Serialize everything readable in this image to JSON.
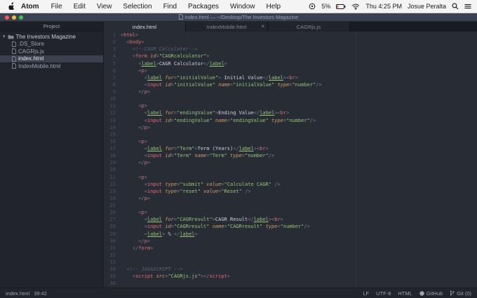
{
  "colors": {
    "editor_bg": "#282c34",
    "panel_bg": "#21252b",
    "titlebar_bg": "#3a4150",
    "tag_red": "#e06c75",
    "string_green": "#98c379",
    "attr_orange": "#d19a66",
    "comment_gray": "#5c6370",
    "selection_bg": "#3a404d"
  },
  "menubar": {
    "app": "Atom",
    "items": [
      "File",
      "Edit",
      "View",
      "Selection",
      "Find",
      "Packages",
      "Window",
      "Help"
    ],
    "battery_percent": "5%",
    "clock": "Thu 4:25 PM",
    "user": "Josue Peralta"
  },
  "window": {
    "title": "index.html — ~/Desktop/The Investors Magazine"
  },
  "sidebar": {
    "header": "Project",
    "root_folder": "The Investors Magazine",
    "files": [
      ".DS_Store",
      "CAGRjs.js",
      "index.html",
      "IndexMobile.html"
    ],
    "selected_file": "index.html"
  },
  "tabs": [
    {
      "label": "index.html",
      "active": true,
      "closable": false
    },
    {
      "label": "IndexMobile.html",
      "active": false,
      "closable": true
    },
    {
      "label": "CAGRjs.js",
      "active": false,
      "closable": false
    }
  ],
  "glyphs": {
    "close": "×",
    "disclosure": "▾"
  },
  "statusbar": {
    "file": "index.html",
    "cursor": "39:42",
    "items": [
      "LF",
      "UTF-8",
      "HTML"
    ],
    "github_label": "GitHub",
    "git_label": "Git (0)"
  },
  "editor": {
    "lines": [
      [
        [
          "pl",
          "<"
        ],
        [
          "tg",
          "html"
        ],
        [
          "pl",
          ">"
        ]
      ],
      [
        [
          "pl",
          "  <"
        ],
        [
          "tg",
          "body"
        ],
        [
          "pl",
          ">"
        ]
      ],
      [
        [
          "cm",
          "    <!--CAGR Calculator-->"
        ]
      ],
      [
        [
          "pl",
          "    <"
        ],
        [
          "tg",
          "form"
        ],
        [
          "pl",
          " "
        ],
        [
          "at",
          "id"
        ],
        [
          "pl",
          "="
        ],
        [
          "st",
          "\"CAGRcalculator\""
        ],
        [
          "pl",
          ">"
        ]
      ],
      [
        [
          "pl",
          "      <"
        ],
        [
          "lb",
          "label"
        ],
        [
          "pl",
          ">"
        ],
        [
          "tx",
          "CAGR Calculator"
        ],
        [
          "pl",
          "</"
        ],
        [
          "lb",
          "label"
        ],
        [
          "pl",
          ">"
        ]
      ],
      [
        [
          "pl",
          "      <"
        ],
        [
          "tg",
          "p"
        ],
        [
          "pl",
          ">"
        ]
      ],
      [
        [
          "pl",
          "        <"
        ],
        [
          "lb",
          "label"
        ],
        [
          "pl",
          " "
        ],
        [
          "at",
          "for"
        ],
        [
          "pl",
          "="
        ],
        [
          "st",
          "\"initialValue\""
        ],
        [
          "pl",
          ">"
        ],
        [
          "tx",
          " Initial Value"
        ],
        [
          "pl",
          "</"
        ],
        [
          "lb",
          "label"
        ],
        [
          "pl",
          "><"
        ],
        [
          "tg",
          "br"
        ],
        [
          "pl",
          ">"
        ]
      ],
      [
        [
          "pl",
          "        <"
        ],
        [
          "tg",
          "input"
        ],
        [
          "pl",
          " "
        ],
        [
          "at",
          "id"
        ],
        [
          "pl",
          "="
        ],
        [
          "st",
          "\"initialValue\""
        ],
        [
          "pl",
          " "
        ],
        [
          "at",
          "name"
        ],
        [
          "pl",
          "="
        ],
        [
          "st",
          "\"initialValue\""
        ],
        [
          "pl",
          " "
        ],
        [
          "at",
          "type"
        ],
        [
          "pl",
          "="
        ],
        [
          "st",
          "\"number\""
        ],
        [
          "pl",
          "/>"
        ]
      ],
      [
        [
          "pl",
          "      </"
        ],
        [
          "tg",
          "p"
        ],
        [
          "pl",
          ">"
        ]
      ],
      [],
      [
        [
          "pl",
          "      <"
        ],
        [
          "tg",
          "p"
        ],
        [
          "pl",
          ">"
        ]
      ],
      [
        [
          "pl",
          "        <"
        ],
        [
          "lb",
          "label"
        ],
        [
          "pl",
          " "
        ],
        [
          "at",
          "for"
        ],
        [
          "pl",
          "="
        ],
        [
          "st",
          "\"endingValue\""
        ],
        [
          "pl",
          ">"
        ],
        [
          "tx",
          "Ending Value"
        ],
        [
          "pl",
          "</"
        ],
        [
          "lb",
          "label"
        ],
        [
          "pl",
          "><"
        ],
        [
          "tg",
          "br"
        ],
        [
          "pl",
          ">"
        ]
      ],
      [
        [
          "pl",
          "        <"
        ],
        [
          "tg",
          "input"
        ],
        [
          "pl",
          " "
        ],
        [
          "at",
          "id"
        ],
        [
          "pl",
          "="
        ],
        [
          "st",
          "\"endingValue\""
        ],
        [
          "pl",
          " "
        ],
        [
          "at",
          "name"
        ],
        [
          "pl",
          "="
        ],
        [
          "st",
          "\"endingValue\""
        ],
        [
          "pl",
          " "
        ],
        [
          "at",
          "type"
        ],
        [
          "pl",
          "="
        ],
        [
          "st",
          "\"number\""
        ],
        [
          "pl",
          "/>"
        ]
      ],
      [
        [
          "pl",
          "      </"
        ],
        [
          "tg",
          "p"
        ],
        [
          "pl",
          ">"
        ]
      ],
      [],
      [
        [
          "pl",
          "      <"
        ],
        [
          "tg",
          "p"
        ],
        [
          "pl",
          ">"
        ]
      ],
      [
        [
          "pl",
          "        <"
        ],
        [
          "lb",
          "label"
        ],
        [
          "pl",
          " "
        ],
        [
          "at",
          "for"
        ],
        [
          "pl",
          "="
        ],
        [
          "st",
          "\"Term\""
        ],
        [
          "pl",
          ">"
        ],
        [
          "tx",
          "Term (Years)"
        ],
        [
          "pl",
          "</"
        ],
        [
          "lb",
          "label"
        ],
        [
          "pl",
          "><"
        ],
        [
          "tg",
          "br"
        ],
        [
          "pl",
          ">"
        ]
      ],
      [
        [
          "pl",
          "        <"
        ],
        [
          "tg",
          "input"
        ],
        [
          "pl",
          " "
        ],
        [
          "at",
          "id"
        ],
        [
          "pl",
          "="
        ],
        [
          "st",
          "\"Term\""
        ],
        [
          "pl",
          " "
        ],
        [
          "at",
          "name"
        ],
        [
          "pl",
          "="
        ],
        [
          "st",
          "\"Term\""
        ],
        [
          "pl",
          " "
        ],
        [
          "at",
          "type"
        ],
        [
          "pl",
          "="
        ],
        [
          "st",
          "\"number\""
        ],
        [
          "pl",
          "/>"
        ]
      ],
      [
        [
          "pl",
          "      </"
        ],
        [
          "tg",
          "p"
        ],
        [
          "pl",
          ">"
        ]
      ],
      [],
      [
        [
          "pl",
          "      <"
        ],
        [
          "tg",
          "p"
        ],
        [
          "pl",
          ">"
        ]
      ],
      [
        [
          "pl",
          "        <"
        ],
        [
          "tg",
          "input"
        ],
        [
          "pl",
          " "
        ],
        [
          "at",
          "type"
        ],
        [
          "pl",
          "="
        ],
        [
          "st",
          "\"submit\""
        ],
        [
          "pl",
          " "
        ],
        [
          "at",
          "value"
        ],
        [
          "pl",
          "="
        ],
        [
          "st",
          "\"Calculate CAGR\""
        ],
        [
          "pl",
          " />"
        ]
      ],
      [
        [
          "pl",
          "        <"
        ],
        [
          "tg",
          "input"
        ],
        [
          "pl",
          " "
        ],
        [
          "at",
          "type"
        ],
        [
          "pl",
          "="
        ],
        [
          "st",
          "\"reset\""
        ],
        [
          "pl",
          " "
        ],
        [
          "at",
          "value"
        ],
        [
          "pl",
          "="
        ],
        [
          "st",
          "\"Reset\""
        ],
        [
          "pl",
          " />"
        ]
      ],
      [
        [
          "pl",
          "      </"
        ],
        [
          "tg",
          "p"
        ],
        [
          "pl",
          ">"
        ]
      ],
      [],
      [
        [
          "pl",
          "      <"
        ],
        [
          "tg",
          "p"
        ],
        [
          "pl",
          ">"
        ]
      ],
      [
        [
          "pl",
          "        <"
        ],
        [
          "lb",
          "label"
        ],
        [
          "pl",
          " "
        ],
        [
          "at",
          "for"
        ],
        [
          "pl",
          "="
        ],
        [
          "st",
          "\"CAGRresult\""
        ],
        [
          "pl",
          ">"
        ],
        [
          "tx",
          "CAGR Result"
        ],
        [
          "pl",
          "</"
        ],
        [
          "lb",
          "label"
        ],
        [
          "pl",
          "><"
        ],
        [
          "tg",
          "br"
        ],
        [
          "pl",
          ">"
        ]
      ],
      [
        [
          "pl",
          "        <"
        ],
        [
          "tg",
          "input"
        ],
        [
          "pl",
          " "
        ],
        [
          "at",
          "id"
        ],
        [
          "pl",
          "="
        ],
        [
          "st",
          "\"CAGRresult\""
        ],
        [
          "pl",
          " "
        ],
        [
          "at",
          "name"
        ],
        [
          "pl",
          "="
        ],
        [
          "st",
          "\"CAGRresult\""
        ],
        [
          "pl",
          " "
        ],
        [
          "at",
          "type"
        ],
        [
          "pl",
          "="
        ],
        [
          "st",
          "\"number\""
        ],
        [
          "pl",
          "/>"
        ]
      ],
      [
        [
          "pl",
          "        <"
        ],
        [
          "lb",
          "label"
        ],
        [
          "pl",
          ">"
        ],
        [
          "tx",
          " % "
        ],
        [
          "pl",
          "</"
        ],
        [
          "lb",
          "label"
        ],
        [
          "pl",
          ">"
        ]
      ],
      [
        [
          "pl",
          "      </"
        ],
        [
          "tg",
          "p"
        ],
        [
          "pl",
          ">"
        ]
      ],
      [
        [
          "pl",
          "    </"
        ],
        [
          "tg",
          "form"
        ],
        [
          "pl",
          ">"
        ]
      ],
      [],
      [],
      [
        [
          "cm",
          "  <!-- JAVASCRIPT -->"
        ]
      ],
      [
        [
          "pl",
          "    <"
        ],
        [
          "tg",
          "script"
        ],
        [
          "pl",
          " "
        ],
        [
          "at",
          "src"
        ],
        [
          "pl",
          "="
        ],
        [
          "st",
          "\"CAGRjs.js\""
        ],
        [
          "pl",
          "></"
        ],
        [
          "tg",
          "script"
        ],
        [
          "pl",
          ">"
        ]
      ],
      []
    ]
  }
}
